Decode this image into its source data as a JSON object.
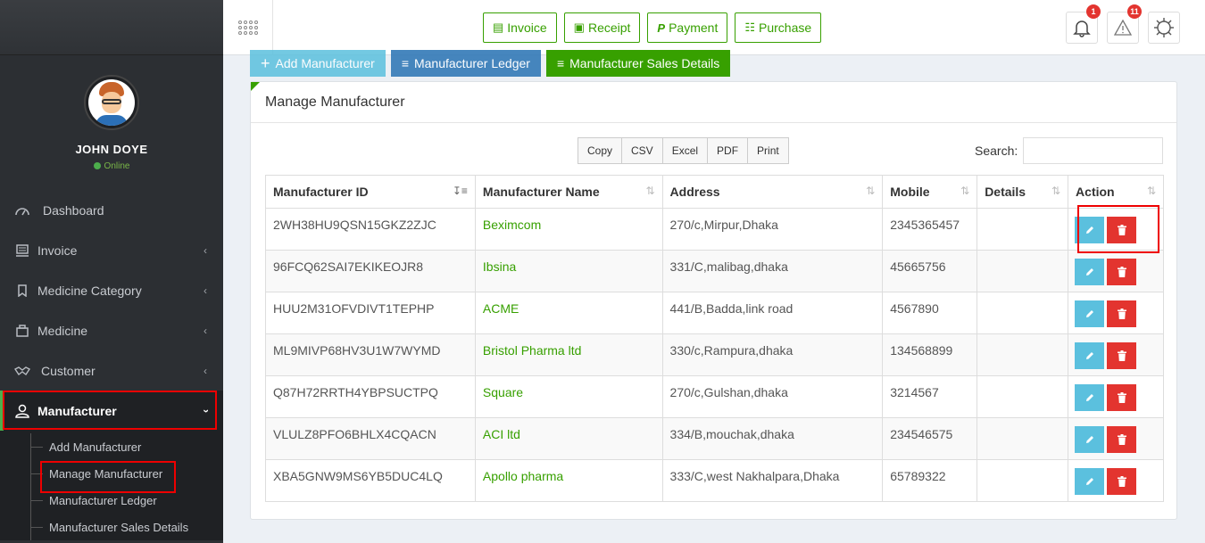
{
  "user": {
    "name": "JOHN DOYE",
    "status": "Online"
  },
  "sidebar": {
    "items": [
      {
        "label": "Dashboard",
        "icon": "dashboard-icon"
      },
      {
        "label": "Invoice",
        "icon": "invoice-icon"
      },
      {
        "label": "Medicine Category",
        "icon": "category-icon"
      },
      {
        "label": "Medicine",
        "icon": "medicine-icon"
      },
      {
        "label": "Customer",
        "icon": "handshake-icon"
      },
      {
        "label": "Manufacturer",
        "icon": "user-icon"
      }
    ],
    "submenu": [
      "Add Manufacturer",
      "Manage Manufacturer",
      "Manufacturer Ledger",
      "Manufacturer Sales Details"
    ]
  },
  "header": {
    "buttons": [
      "Invoice",
      "Receipt",
      "Payment",
      "Purchase"
    ],
    "notifications_count": "1",
    "alerts_count": "11"
  },
  "actions": {
    "add": "Add Manufacturer",
    "ledger": "Manufacturer Ledger",
    "sales": "Manufacturer Sales Details"
  },
  "panel": {
    "title": "Manage Manufacturer",
    "export": [
      "Copy",
      "CSV",
      "Excel",
      "PDF",
      "Print"
    ],
    "search_label": "Search:",
    "search_value": ""
  },
  "table": {
    "columns": [
      "Manufacturer ID",
      "Manufacturer Name",
      "Address",
      "Mobile",
      "Details",
      "Action"
    ],
    "rows": [
      {
        "id": "2WH38HU9QSN15GKZ2ZJC",
        "name": "Beximcom",
        "address": "270/c,Mirpur,Dhaka",
        "mobile": "2345365457",
        "details": ""
      },
      {
        "id": "96FCQ62SAI7EKIKEOJR8",
        "name": "Ibsina",
        "address": "331/C,malibag,dhaka",
        "mobile": "45665756",
        "details": ""
      },
      {
        "id": "HUU2M31OFVDIVT1TEPHP",
        "name": "ACME",
        "address": "441/B,Badda,link road",
        "mobile": "4567890",
        "details": ""
      },
      {
        "id": "ML9MIVP68HV3U1W7WYMD",
        "name": "Bristol Pharma ltd",
        "address": "330/c,Rampura,dhaka",
        "mobile": "134568899",
        "details": ""
      },
      {
        "id": "Q87H72RRTH4YBPSUCTPQ",
        "name": "Square",
        "address": "270/c,Gulshan,dhaka",
        "mobile": "3214567",
        "details": ""
      },
      {
        "id": "VLULZ8PFO6BHLX4CQACN",
        "name": "ACI ltd",
        "address": "334/B,mouchak,dhaka",
        "mobile": "234546575",
        "details": ""
      },
      {
        "id": "XBA5GNW9MS6YB5DUC4LQ",
        "name": "Apollo pharma",
        "address": "333/C,west Nakhalpara,Dhaka",
        "mobile": "65789322",
        "details": ""
      }
    ]
  },
  "colors": {
    "accent": "#37a000",
    "danger": "#e3342f",
    "info": "#5bc0de",
    "primary": "#337ab7"
  }
}
